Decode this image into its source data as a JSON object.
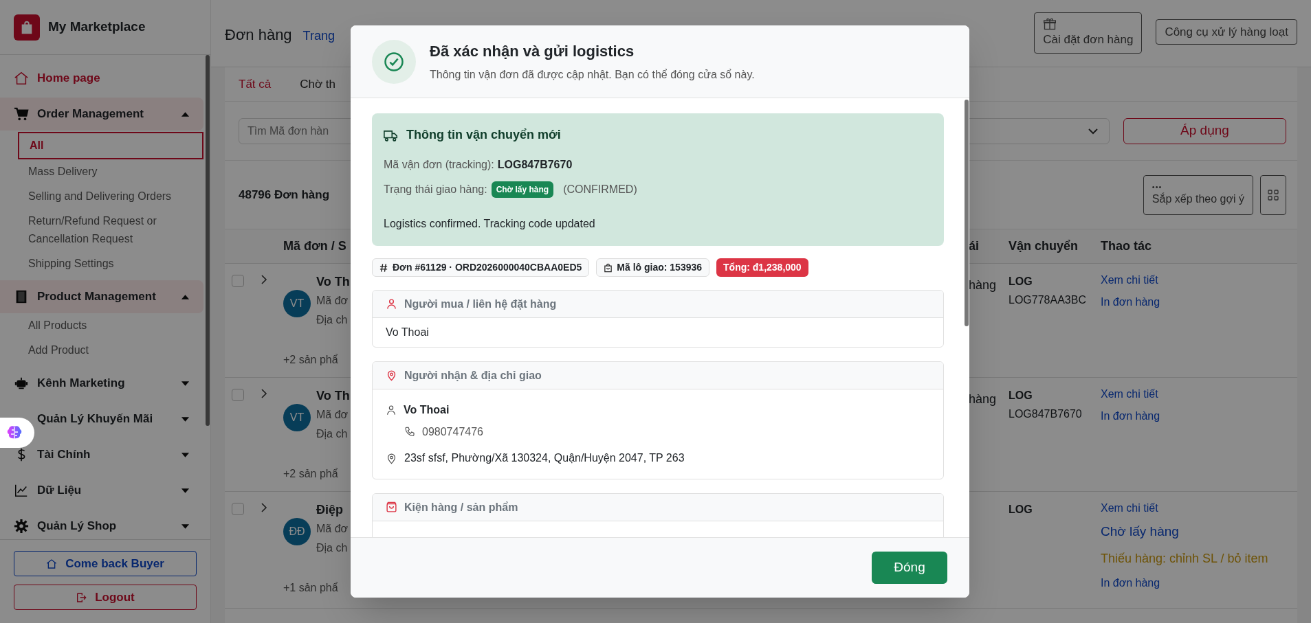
{
  "sidebar": {
    "brand": "My Marketplace",
    "items": [
      {
        "label": "Home page",
        "kind": "link"
      },
      {
        "label": "Order Management",
        "kind": "group",
        "expanded": true,
        "children": [
          {
            "label": "All",
            "selected": true
          },
          {
            "label": "Mass Delivery",
            "selected": false
          },
          {
            "label": "Selling and Delivering Orders",
            "selected": false
          },
          {
            "label": "Return/Refund Request or Cancellation Request",
            "selected": false
          },
          {
            "label": "Shipping Settings",
            "selected": false
          }
        ]
      },
      {
        "label": "Product Management",
        "kind": "group",
        "expanded": true,
        "children": [
          {
            "label": "All Products",
            "selected": false
          },
          {
            "label": "Add Product",
            "selected": false
          }
        ]
      },
      {
        "label": "Kênh Marketing",
        "kind": "group",
        "expanded": false
      },
      {
        "label": "Quản Lý Khuyến Mãi",
        "kind": "group",
        "expanded": false
      },
      {
        "label": "Tài Chính",
        "kind": "group",
        "expanded": false
      },
      {
        "label": "Dữ Liệu",
        "kind": "group",
        "expanded": false
      },
      {
        "label": "Quản Lý Shop",
        "kind": "group",
        "expanded": false
      }
    ],
    "buttons": [
      "Come back Buyer",
      "Logout"
    ]
  },
  "header": {
    "title": "Đơn hàng",
    "breadcrumb": "Trang",
    "buttons": [
      "Cài đặt đơn hàng",
      "Công cụ xử lý hàng loạt"
    ]
  },
  "tabs": [
    {
      "label": "Tất cả",
      "selected": true
    },
    {
      "label": "Chờ th",
      "selected": false
    }
  ],
  "filters": {
    "search_placeholder": "Tìm Mã đơn hàn",
    "apply": "Áp dụng"
  },
  "count": "48796 Đơn hàng",
  "sort": {
    "dots": "•••",
    "label": "Sắp xếp theo gợi ý"
  },
  "table": {
    "columns": [
      "Mã đơn / S",
      "ái",
      "Vận chuyển",
      "Thao tác"
    ],
    "rows": [
      {
        "checked": false,
        "avatar": "VT",
        "name": "Vo Th",
        "code": "Mã đơ",
        "address": "Địa ch",
        "more": "+2 sản phẩ",
        "status": "hàng",
        "carrier": "LOG",
        "tracking": "LOG778AA3BC",
        "actions": [
          {
            "label": "Xem chi tiết",
            "kind": "link"
          },
          {
            "label": "In đơn hàng",
            "kind": "link"
          }
        ]
      },
      {
        "checked": false,
        "avatar": "VT",
        "name": "Vo Th",
        "code": "Mã đơ",
        "address": "Địa ch",
        "more": "+2 sản phẩ",
        "status": "hàng",
        "carrier": "LOG",
        "tracking": "LOG847B7670",
        "actions": [
          {
            "label": "Xem chi tiết",
            "kind": "link"
          },
          {
            "label": "In đơn hàng",
            "kind": "link"
          }
        ]
      },
      {
        "checked": false,
        "avatar": "ĐĐ",
        "name": "Điệp",
        "code": "Mã đơ",
        "address": "Địa ch",
        "more": "+1 sản phẩ",
        "carrier": "LOG",
        "actions": [
          {
            "label": "Xem chi tiết",
            "kind": "link"
          },
          {
            "label": "Chờ lấy hàng",
            "kind": "status"
          },
          {
            "label": "Thiếu hàng: chỉnh SL / bỏ item",
            "kind": "warning"
          },
          {
            "label": "In đơn hàng",
            "kind": "link"
          }
        ]
      }
    ]
  },
  "dialog": {
    "title": "Đã xác nhận và gửi logistics",
    "subtitle": "Thông tin vận đơn đã được cập nhật. Bạn có thể đóng cửa sổ này.",
    "shipping": {
      "title": "Thông tin vận chuyển mới",
      "tracking_label": "Mã vận đơn (tracking):",
      "tracking": "LOG847B7670",
      "status_label": "Trạng thái giao hàng:",
      "status_badge": "Chờ lấy hàng",
      "status_code": "(CONFIRMED)",
      "message": "Logistics confirmed. Tracking code updated"
    },
    "chips": [
      {
        "kind": "order",
        "text": "Đơn #61129 · ORD2026000040CBAA0ED5"
      },
      {
        "kind": "batch",
        "text": "Mã lô giao: 153936"
      },
      {
        "kind": "total",
        "text": "Tổng: đ1,238,000"
      }
    ],
    "buyer": {
      "title": "Người mua / liên hệ đặt hàng",
      "name": "Vo Thoai"
    },
    "recipient": {
      "title": "Người nhận & địa chỉ giao",
      "name": "Vo Thoai",
      "phone": "0980747476",
      "address": "23sf sfsf, Phường/Xã 130324, Quận/Huyện 2047, TP 263"
    },
    "package": {
      "title": "Kiện hàng / sản phẩm"
    },
    "close": "Đóng"
  }
}
